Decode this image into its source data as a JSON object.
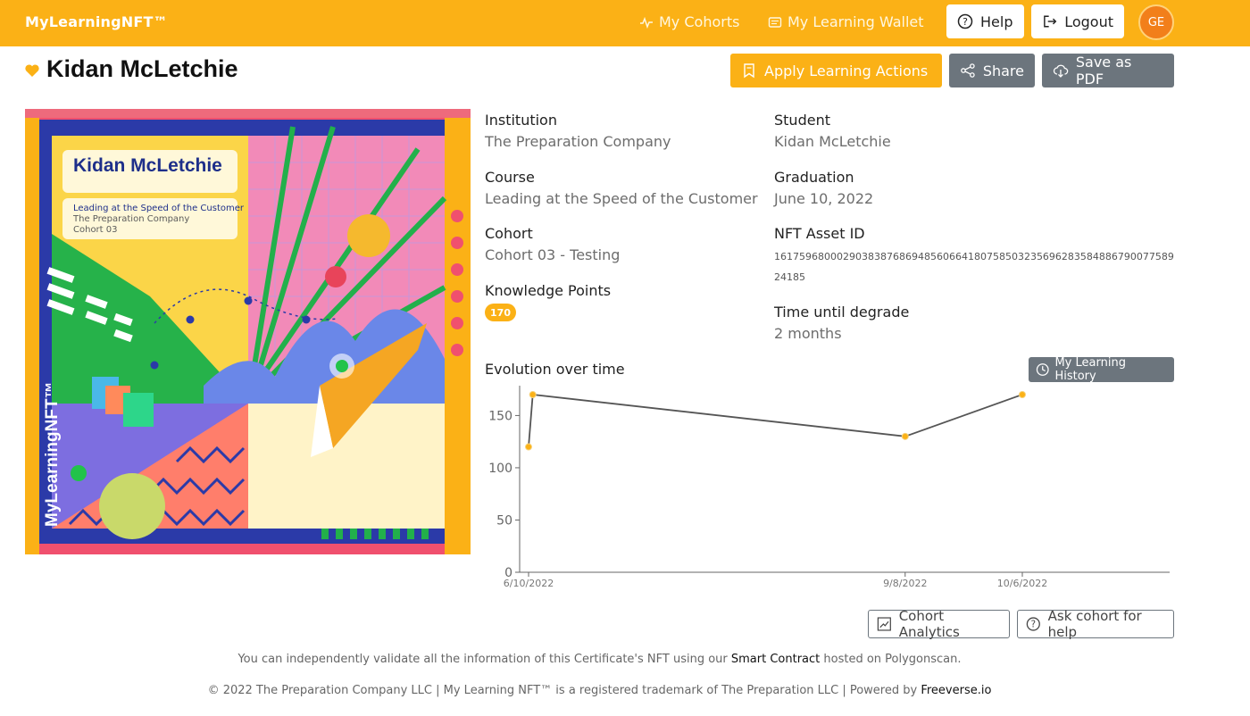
{
  "header": {
    "brand": "MyLearningNFT™",
    "nav": [
      {
        "label": "My Cohorts",
        "icon": "activity-icon"
      },
      {
        "label": "My Learning Wallet",
        "icon": "wallet-icon"
      }
    ],
    "help_label": "Help",
    "logout_label": "Logout",
    "avatar_initials": "GE"
  },
  "page": {
    "title": "Kidan McLetchie",
    "favorite_icon": "heart-icon",
    "actions": {
      "apply_label": "Apply Learning Actions",
      "share_label": "Share",
      "save_pdf_label": "Save as PDF"
    }
  },
  "artwork": {
    "name": "Kidan McLetchie",
    "course": "Leading at the Speed of the Customer",
    "institution": "The Preparation Company",
    "cohort": "Cohort 03",
    "vertical_brand": "MyLearningNFT™"
  },
  "details": {
    "institution_label": "Institution",
    "institution_value": "The Preparation Company",
    "student_label": "Student",
    "student_value": "Kidan McLetchie",
    "course_label": "Course",
    "course_value": "Leading at the Speed of the Customer",
    "graduation_label": "Graduation",
    "graduation_value": "June 10, 2022",
    "cohort_label": "Cohort",
    "cohort_value": "Cohort 03 - Testing",
    "nft_label": "NFT Asset ID",
    "nft_value": "161759680002903838768694856066418075850323569628358488679007758924185",
    "kp_label": "Knowledge Points",
    "kp_value": "170",
    "degrade_label": "Time until degrade",
    "degrade_value": "2 months"
  },
  "chart_data": {
    "type": "line",
    "title": "Evolution over time",
    "xlabel": "",
    "ylabel": "",
    "x_tick_labels": [
      "6/10/2022",
      "9/8/2022",
      "10/6/2022"
    ],
    "y_ticks": [
      0,
      50,
      100,
      150
    ],
    "ylim": [
      0,
      170
    ],
    "grid": false,
    "point_color": "#fbb116",
    "line_color": "#555555",
    "points": [
      {
        "x": "2022-06-10",
        "y": 120
      },
      {
        "x": "2022-06-11",
        "y": 170
      },
      {
        "x": "2022-09-08",
        "y": 130
      },
      {
        "x": "2022-10-06",
        "y": 170
      }
    ]
  },
  "history_label": "My Learning History",
  "bottom_actions": {
    "analytics_label": "Cohort Analytics",
    "ask_help_label": "Ask cohort for help"
  },
  "footer": {
    "validate_pre": "You can independently validate all the information of this Certificate's NFT using our ",
    "smart_contract": "Smart Contract",
    "validate_post": " hosted on Polygonscan.",
    "copyright": "© 2022 The Preparation Company LLC | My Learning NFT™ is a registered trademark of The Preparation LLC | Powered by ",
    "powered_by": "Freeverse.io"
  },
  "colors": {
    "accent": "#fbb116",
    "button_grey": "#6c757d",
    "avatar": "#f27f1a"
  }
}
